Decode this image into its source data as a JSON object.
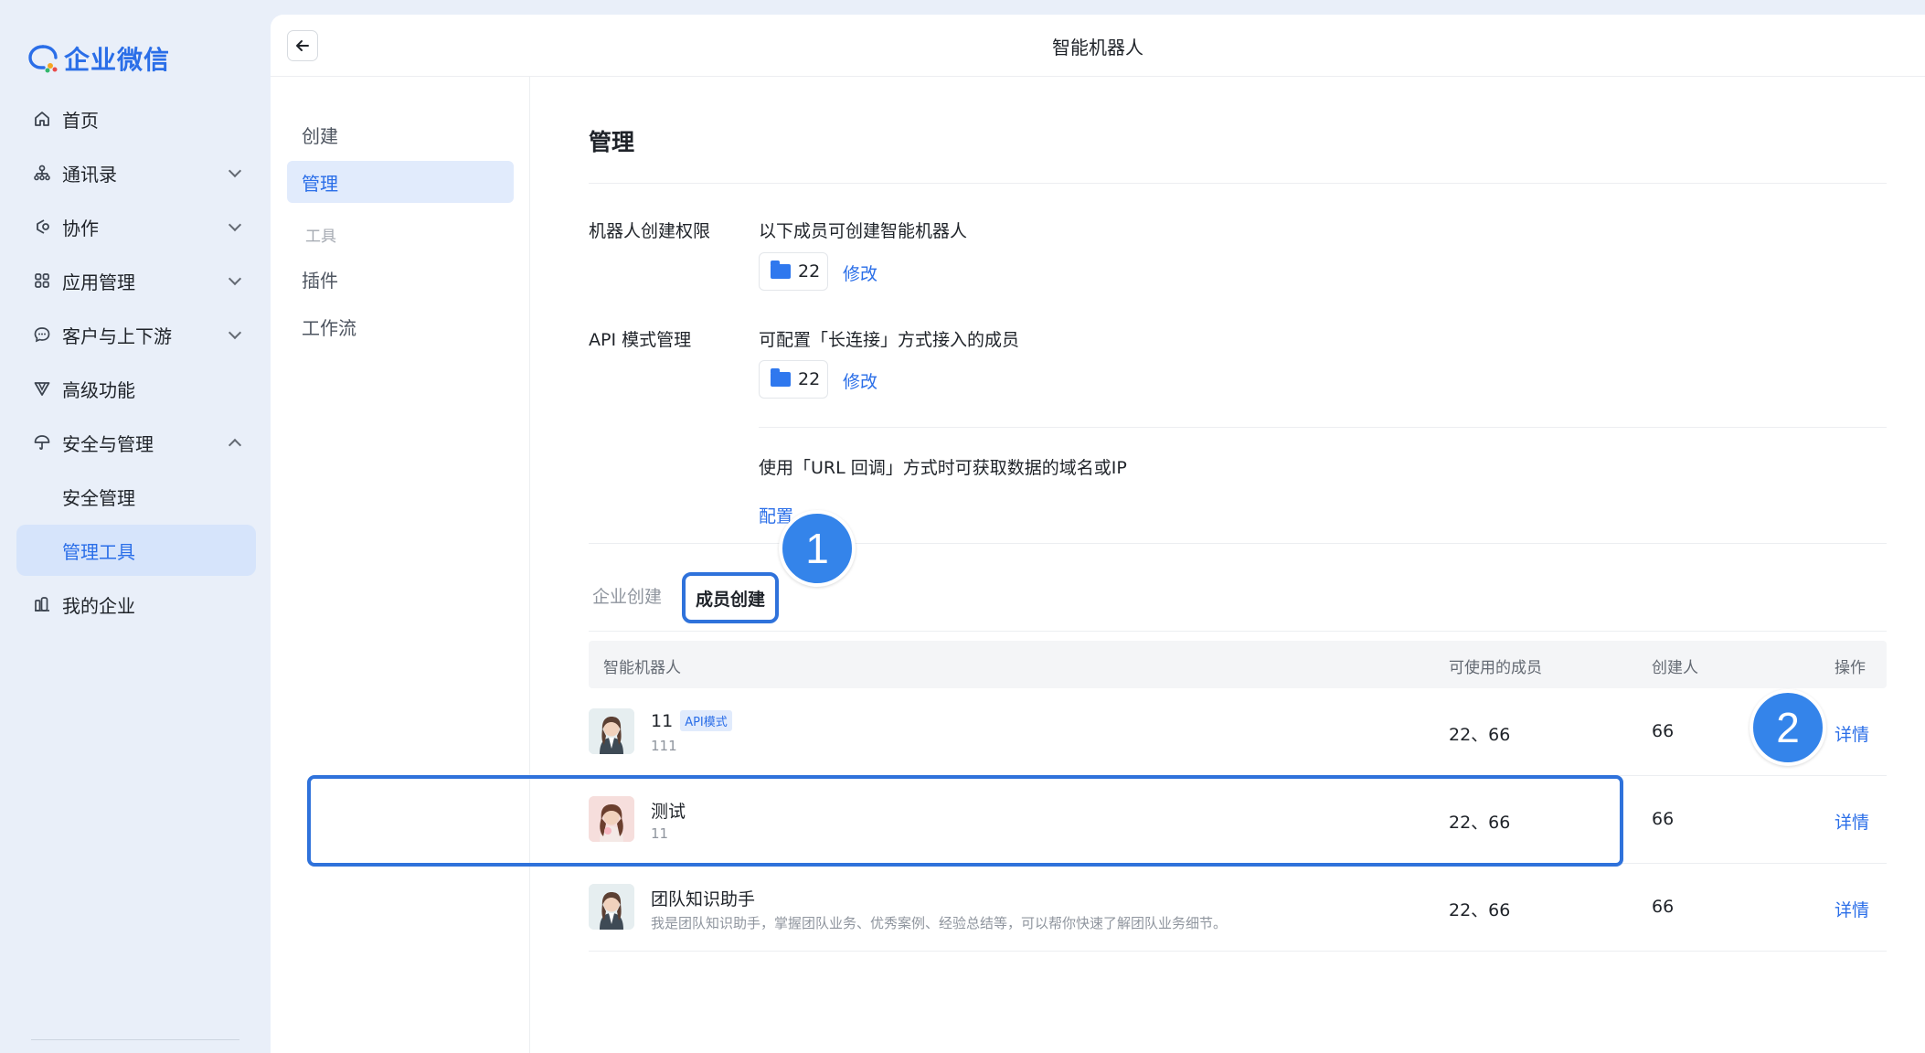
{
  "brand": {
    "name": "企业微信",
    "color": "#2a6ee8"
  },
  "sidebar": {
    "items": [
      {
        "label": "首页",
        "icon": "home-icon"
      },
      {
        "label": "通讯录",
        "icon": "org-chart-icon",
        "expandable": true
      },
      {
        "label": "协作",
        "icon": "collaboration-icon",
        "expandable": true
      },
      {
        "label": "应用管理",
        "icon": "apps-grid-icon",
        "expandable": true
      },
      {
        "label": "客户与上下游",
        "icon": "chat-bubble-icon",
        "expandable": true
      },
      {
        "label": "高级功能",
        "icon": "advanced-icon"
      },
      {
        "label": "安全与管理",
        "icon": "umbrella-icon",
        "expanded": true
      },
      {
        "label": "安全管理",
        "sub": true
      },
      {
        "label": "管理工具",
        "sub": true,
        "active": true
      },
      {
        "label": "我的企业",
        "icon": "company-icon"
      }
    ]
  },
  "topbar": {
    "title": "智能机器人"
  },
  "menu2": {
    "create_label": "创建",
    "manage_label": "管理",
    "tools_group": "工具",
    "plugin_label": "插件",
    "workflow_label": "工作流"
  },
  "content": {
    "title": "管理",
    "perm": {
      "label": "机器人创建权限",
      "desc": "以下成员可创建智能机器人",
      "count": "22",
      "edit": "修改"
    },
    "api": {
      "label": "API 模式管理",
      "desc": "可配置「长连接」方式接入的成员",
      "count": "22",
      "edit": "修改"
    },
    "url": {
      "desc": "使用「URL 回调」方式时可获取数据的域名或IP",
      "config": "配置"
    },
    "tabs": {
      "enterprise": "企业创建",
      "member": "成员创建"
    },
    "table": {
      "headers": {
        "bot": "智能机器人",
        "members": "可使用的成员",
        "creator": "创建人",
        "action": "操作"
      },
      "rows": [
        {
          "name": "11",
          "tag": "API模式",
          "desc": "111",
          "members": "22、66",
          "creator": "66",
          "action": "详情"
        },
        {
          "name": "测试",
          "tag": "",
          "desc": "11",
          "members": "22、66",
          "creator": "66",
          "action": "详情"
        },
        {
          "name": "团队知识助手",
          "tag": "",
          "desc": "我是团队知识助手，掌握团队业务、优秀案例、经验总结等，可以帮你快速了解团队业务细节。",
          "members": "22、66",
          "creator": "66",
          "action": "详情"
        }
      ]
    }
  },
  "annotations": {
    "marker1": "1",
    "marker2": "2",
    "color": "#3484ea"
  }
}
